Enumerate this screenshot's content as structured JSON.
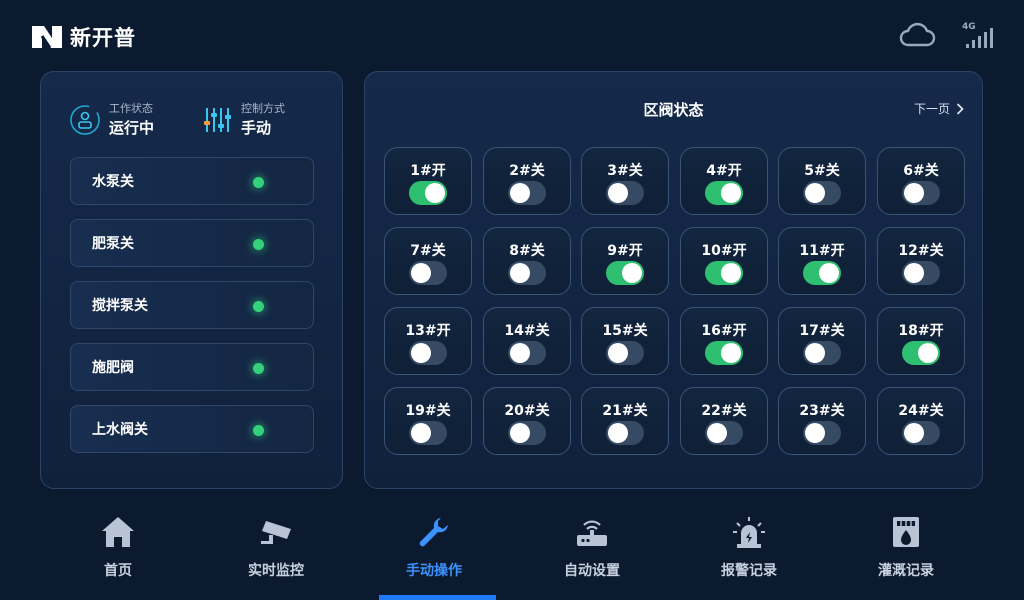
{
  "header": {
    "brand": "新开普",
    "signal_label": "4G",
    "icons": {
      "cloud": "cloud-icon",
      "signal": "signal-icon"
    }
  },
  "colors": {
    "background": "#0b1a2e",
    "accent": "#1f7cff",
    "on": "#2fbf71",
    "off": "#374a63",
    "status_dot": "#33d17a"
  },
  "left_panel": {
    "work_status": {
      "label": "工作状态",
      "value": "运行中",
      "icon": "person-badge-icon"
    },
    "control_mode": {
      "label": "控制方式",
      "value": "手动",
      "icon": "sliders-icon"
    },
    "devices": [
      {
        "name": "水泵关",
        "indicator": "green"
      },
      {
        "name": "肥泵关",
        "indicator": "green"
      },
      {
        "name": "搅拌泵关",
        "indicator": "green"
      },
      {
        "name": "施肥阀",
        "indicator": "green"
      },
      {
        "name": "上水阀关",
        "indicator": "green"
      }
    ]
  },
  "right_panel": {
    "title": "区阀状态",
    "next_page": "下一页",
    "valves": [
      {
        "label": "1#开",
        "on": true
      },
      {
        "label": "2#关",
        "on": false
      },
      {
        "label": "3#关",
        "on": false
      },
      {
        "label": "4#开",
        "on": true
      },
      {
        "label": "5#关",
        "on": false
      },
      {
        "label": "6#关",
        "on": false
      },
      {
        "label": "7#关",
        "on": false
      },
      {
        "label": "8#关",
        "on": false
      },
      {
        "label": "9#开",
        "on": true
      },
      {
        "label": "10#开",
        "on": true
      },
      {
        "label": "11#开",
        "on": true
      },
      {
        "label": "12#关",
        "on": false
      },
      {
        "label": "13#开",
        "on": false
      },
      {
        "label": "14#关",
        "on": false
      },
      {
        "label": "15#关",
        "on": false
      },
      {
        "label": "16#开",
        "on": true
      },
      {
        "label": "17#关",
        "on": false
      },
      {
        "label": "18#开",
        "on": true
      },
      {
        "label": "19#关",
        "on": false
      },
      {
        "label": "20#关",
        "on": false
      },
      {
        "label": "21#关",
        "on": false
      },
      {
        "label": "22#关",
        "on": false
      },
      {
        "label": "23#关",
        "on": false
      },
      {
        "label": "24#关",
        "on": false
      }
    ]
  },
  "nav": {
    "active_index": 2,
    "items": [
      {
        "label": "首页",
        "icon": "home-icon"
      },
      {
        "label": "实时监控",
        "icon": "camera-icon"
      },
      {
        "label": "手动操作",
        "icon": "wrench-icon"
      },
      {
        "label": "自动设置",
        "icon": "router-icon"
      },
      {
        "label": "报警记录",
        "icon": "alarm-icon"
      },
      {
        "label": "灌溉记录",
        "icon": "irrigation-record-icon"
      }
    ]
  }
}
